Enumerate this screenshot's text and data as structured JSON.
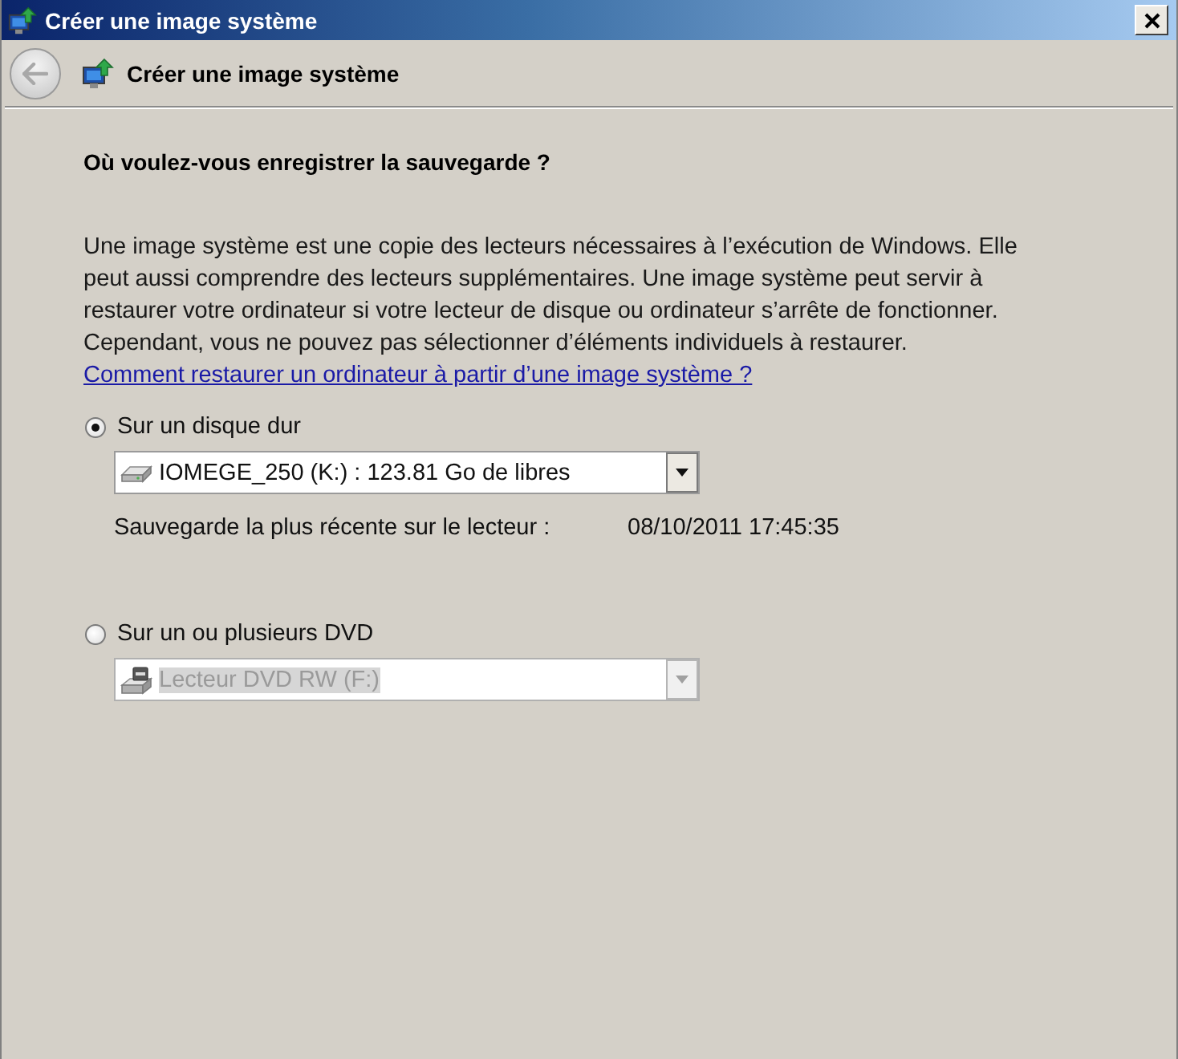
{
  "window": {
    "title": "Créer une image système"
  },
  "header": {
    "title": "Créer une image système",
    "back_button": {
      "disabled": true
    }
  },
  "question": "Où voulez-vous enregistrer la sauvegarde ?",
  "description": {
    "text": "Une image système est une copie des lecteurs nécessaires à l’exécution de Windows. Elle peut aussi comprendre des lecteurs supplémentaires. Une image système peut servir à restaurer votre ordinateur si votre lecteur de disque ou ordinateur s’arrête de fonctionner. Cependant, vous ne pouvez pas sélectionner d’éléments individuels à restaurer.",
    "link": "Comment restaurer un ordinateur à partir d’une image système ?"
  },
  "destinations": [
    {
      "kind": "disk",
      "label": "Sur un disque dur",
      "selected": true,
      "dropdown": {
        "value": "IOMEGE_250 (K:) : 123.81 Go de libres",
        "disabled": false
      },
      "latest_backup": {
        "label": "Sauvegarde la plus récente sur le lecteur :",
        "value": "08/10/2011 17:45:35"
      }
    },
    {
      "kind": "dvd",
      "label": "Sur un ou plusieurs DVD",
      "selected": false,
      "dropdown": {
        "value": "Lecteur DVD RW (F:)",
        "disabled": true
      }
    }
  ]
}
